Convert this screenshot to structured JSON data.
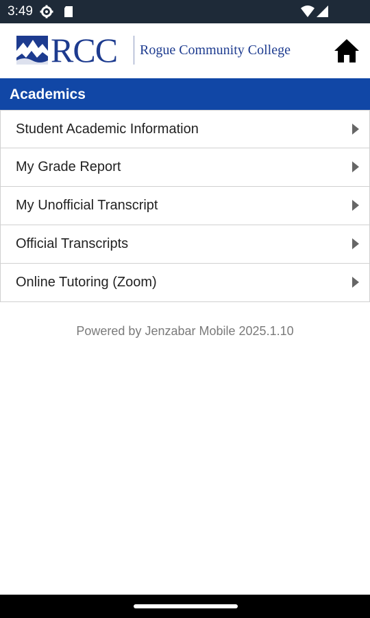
{
  "status_bar": {
    "time": "3:49",
    "icons": [
      "settings-icon",
      "sd-card-icon",
      "wifi-icon",
      "signal-icon"
    ]
  },
  "header": {
    "logo_text": "RCC",
    "logo_subtitle": "Rogue Community College",
    "home_icon": "home-icon"
  },
  "section": {
    "title": "Academics"
  },
  "menu": {
    "items": [
      {
        "label": "Student Academic Information"
      },
      {
        "label": "My Grade Report"
      },
      {
        "label": "My Unofficial Transcript"
      },
      {
        "label": "Official Transcripts"
      },
      {
        "label": "Online Tutoring (Zoom)"
      }
    ]
  },
  "footer": {
    "text": "Powered by Jenzabar Mobile 2025.1.10"
  },
  "colors": {
    "status_bar": "#1e2a38",
    "brand_blue": "#1d3b8f",
    "section_bar": "#1147a6",
    "footer_text": "#7a7a7a"
  }
}
